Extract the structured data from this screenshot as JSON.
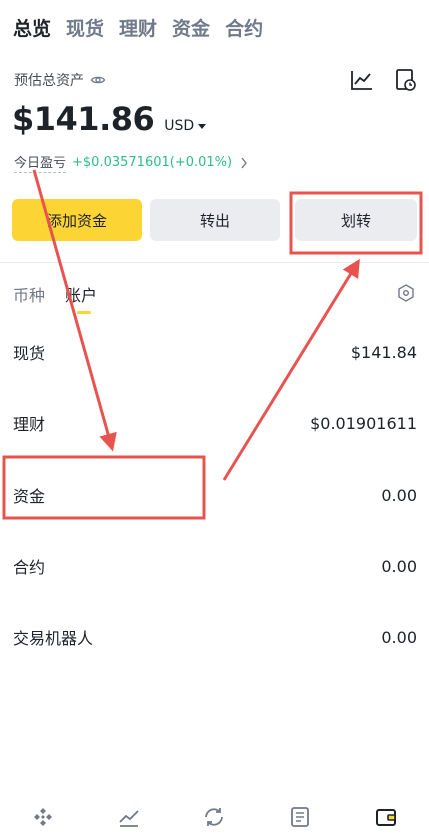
{
  "top_tabs": [
    "总览",
    "现货",
    "理财",
    "资金",
    "合约"
  ],
  "summary": {
    "label": "预估总资产",
    "amount": "$141.86",
    "currency": "USD",
    "pnl_label": "今日盈亏",
    "pnl_value": "+$0.03571601(+0.01%)"
  },
  "buttons": {
    "deposit": "添加资金",
    "withdraw": "转出",
    "transfer": "划转"
  },
  "sub_tabs": [
    "币种",
    "账户"
  ],
  "accounts": [
    {
      "name": "现货",
      "value": "$141.84"
    },
    {
      "name": "理财",
      "value": "$0.01901611"
    },
    {
      "name": "资金",
      "value": "0.00"
    },
    {
      "name": "合约",
      "value": "0.00"
    },
    {
      "name": "交易机器人",
      "value": "0.00"
    }
  ],
  "colors": {
    "accent": "#fcd535",
    "positive": "#2ebd85",
    "annotation": "#e8534f"
  },
  "icons": [
    "eye-icon",
    "line-chart-icon",
    "history-icon",
    "chevron-right-icon",
    "settings-hex-icon",
    "home-logo-icon",
    "markets-icon",
    "trade-icon",
    "orders-icon",
    "wallet-icon"
  ]
}
